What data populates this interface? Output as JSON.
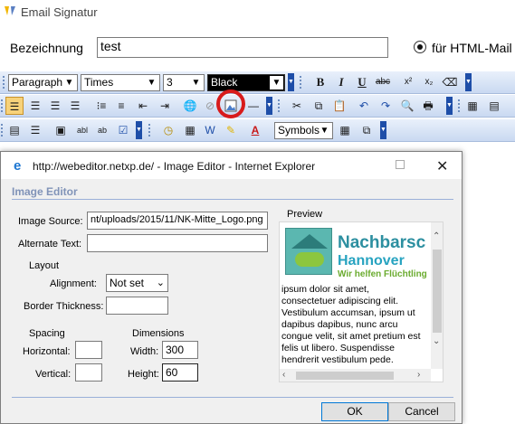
{
  "window": {
    "title": "Email Signatur"
  },
  "form": {
    "bezeichnung_label": "Bezeichnung",
    "bezeichnung_value": "test",
    "html_mail_label": "für HTML-Mail"
  },
  "toolbar": {
    "format_value": "Paragraph",
    "font_value": "Times",
    "size_value": "3",
    "color_value": "Black",
    "bold": "B",
    "italic": "I",
    "underline": "U",
    "strike": "abc",
    "superscript": "x²",
    "subscript": "x₂",
    "symbols_value": "Symbols",
    "textfield1": "abl",
    "textfield2": "ab"
  },
  "dialog": {
    "title": "http://webeditor.netxp.de/ - Image Editor - Internet Explorer",
    "heading": "Image Editor",
    "image_source_label": "Image Source:",
    "image_source_value": "nt/uploads/2015/11/NK-Mitte_Logo.png",
    "alternate_text_label": "Alternate Text:",
    "alternate_text_value": "",
    "layout_label": "Layout",
    "alignment_label": "Alignment:",
    "alignment_value": "Not set",
    "border_label": "Border Thickness:",
    "border_value": "",
    "spacing_label": "Spacing",
    "horizontal_label": "Horizontal:",
    "horizontal_value": "",
    "vertical_label": "Vertical:",
    "vertical_value": "",
    "dimensions_label": "Dimensions",
    "width_label": "Width:",
    "width_value": "300",
    "height_label": "Height:",
    "height_value": "60",
    "preview_label": "Preview",
    "preview_logo_line1": "Nachbarsc",
    "preview_logo_line2": "Hannover",
    "preview_logo_line3": "Wir helfen Flüchtling",
    "preview_text": "ipsum dolor sit amet,\nconsectetuer adipiscing elit.\nVestibulum accumsan, ipsum ut\ndapibus dapibus, nunc arcu\ncongue velit, sit amet pretium est\nfelis ut libero. Suspendisse\nhendrerit vestibulum pede.",
    "ok_label": "OK",
    "cancel_label": "Cancel"
  },
  "colors": {
    "accent": "#1e4ea8",
    "highlight_circle": "#d81b1b",
    "toolbar_bg": "#d4e1f5"
  }
}
